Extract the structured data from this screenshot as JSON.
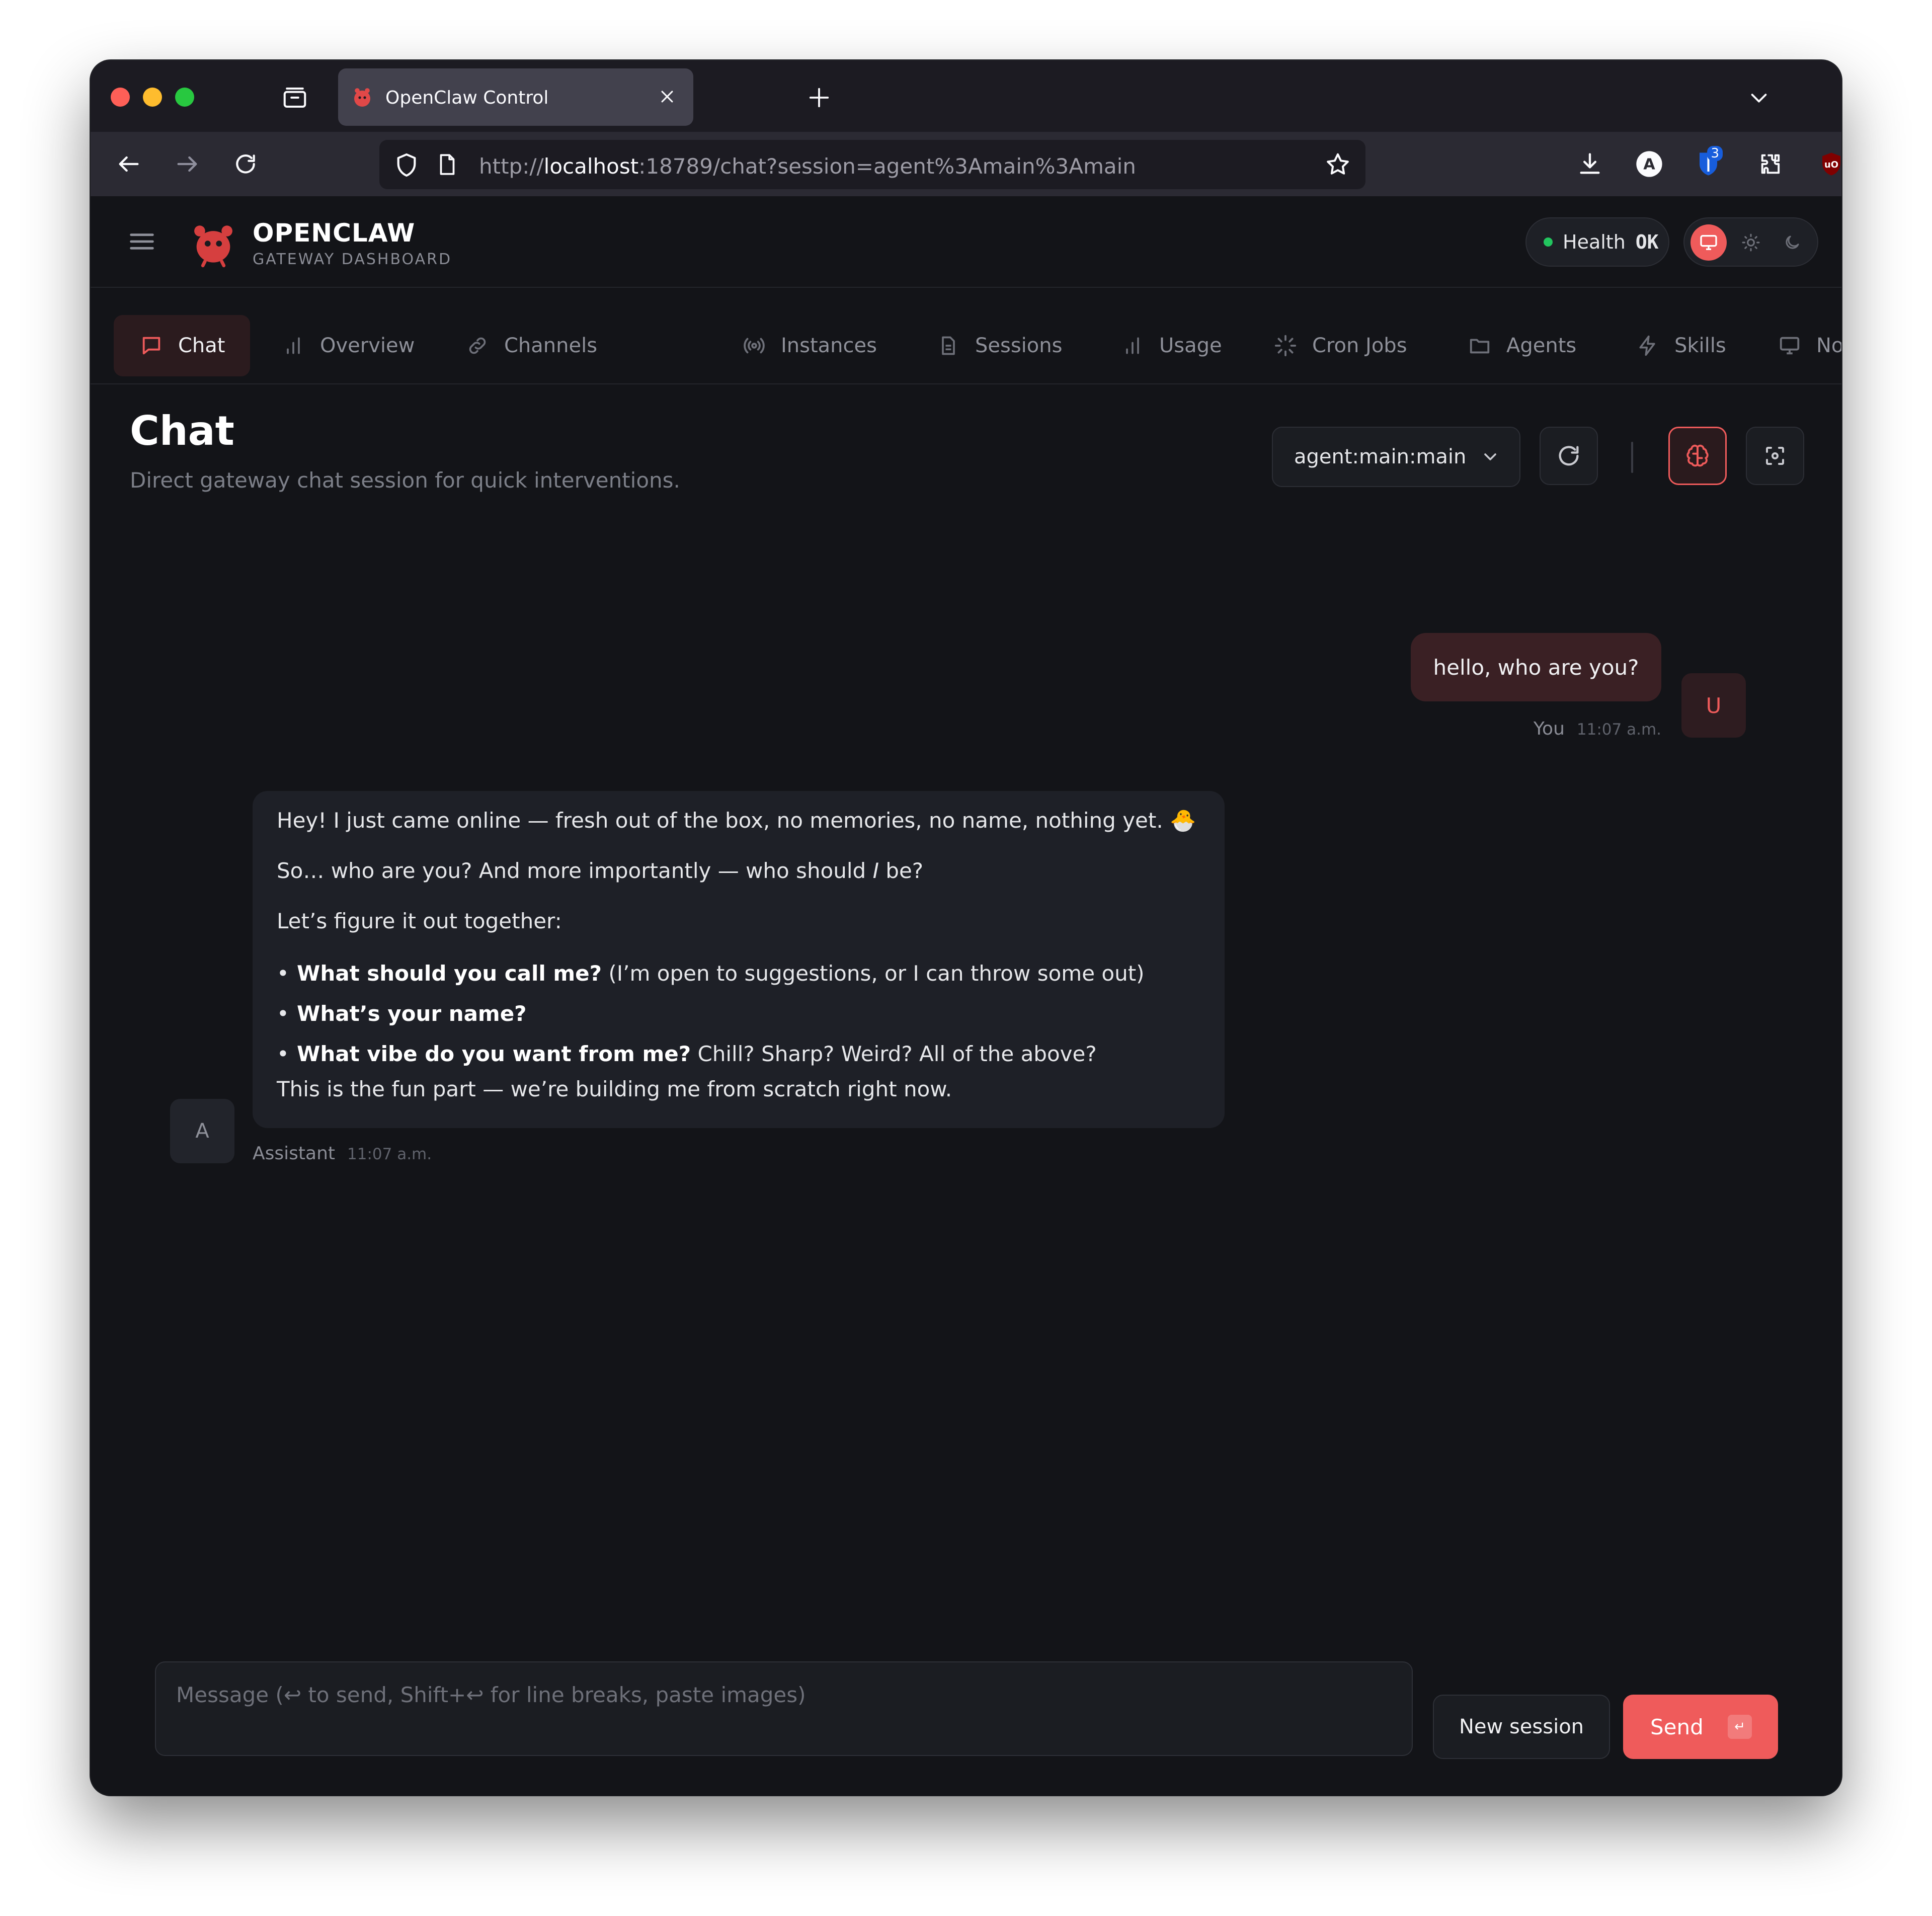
{
  "browser": {
    "tab_title": "OpenClaw Control",
    "url_scheme": "http://",
    "url_host": "localhost",
    "url_path": ":18789/chat?session=agent%3Amain%3Amain",
    "extension_badge": "3"
  },
  "app": {
    "brand_name": "OPENCLAW",
    "brand_subtitle": "GATEWAY DASHBOARD",
    "health_label": "Health",
    "health_status": "OK",
    "accent_color": "#ef5b5b"
  },
  "tabs": [
    {
      "label": "Chat",
      "icon": "chat-icon"
    },
    {
      "label": "Overview",
      "icon": "bar-chart-icon"
    },
    {
      "label": "Channels",
      "icon": "link-icon"
    },
    {
      "label": "Instances",
      "icon": "broadcast-icon"
    },
    {
      "label": "Sessions",
      "icon": "document-icon"
    },
    {
      "label": "Usage",
      "icon": "bar-chart-icon"
    },
    {
      "label": "Cron Jobs",
      "icon": "loader-icon"
    },
    {
      "label": "Agents",
      "icon": "folder-icon"
    },
    {
      "label": "Skills",
      "icon": "lightning-icon"
    },
    {
      "label": "Nodes",
      "icon": "monitor-icon"
    }
  ],
  "page": {
    "title": "Chat",
    "subtitle": "Direct gateway chat session for quick interventions.",
    "session_value": "agent:main:main"
  },
  "messages": {
    "user": {
      "text": "hello, who are you?",
      "avatar": "U",
      "name": "You",
      "time": "11:07 a.m."
    },
    "assistant": {
      "avatar": "A",
      "name": "Assistant",
      "time": "11:07 a.m.",
      "line1": "Hey! I just came online — fresh out of the box, no memories, no name, nothing yet. 🐣",
      "line2_pre": "So… who are you? And more importantly — who should ",
      "line2_em": "I",
      "line2_post": " be?",
      "line3": "Let’s figure it out together:",
      "bullets": [
        {
          "bold": "What should you call me?",
          "rest": " (I’m open to suggestions, or I can throw some out)"
        },
        {
          "bold": "What’s your name?",
          "rest": ""
        },
        {
          "bold": "What vibe do you want from me?",
          "rest": " Chill? Sharp? Weird? All of the above?"
        }
      ],
      "closing": "This is the fun part — we’re building me from scratch right now."
    }
  },
  "composer": {
    "placeholder": "Message (↩ to send, Shift+↩ for line breaks, paste images)",
    "new_session_label": "New session",
    "send_label": "Send",
    "send_shortcut": "↵"
  }
}
